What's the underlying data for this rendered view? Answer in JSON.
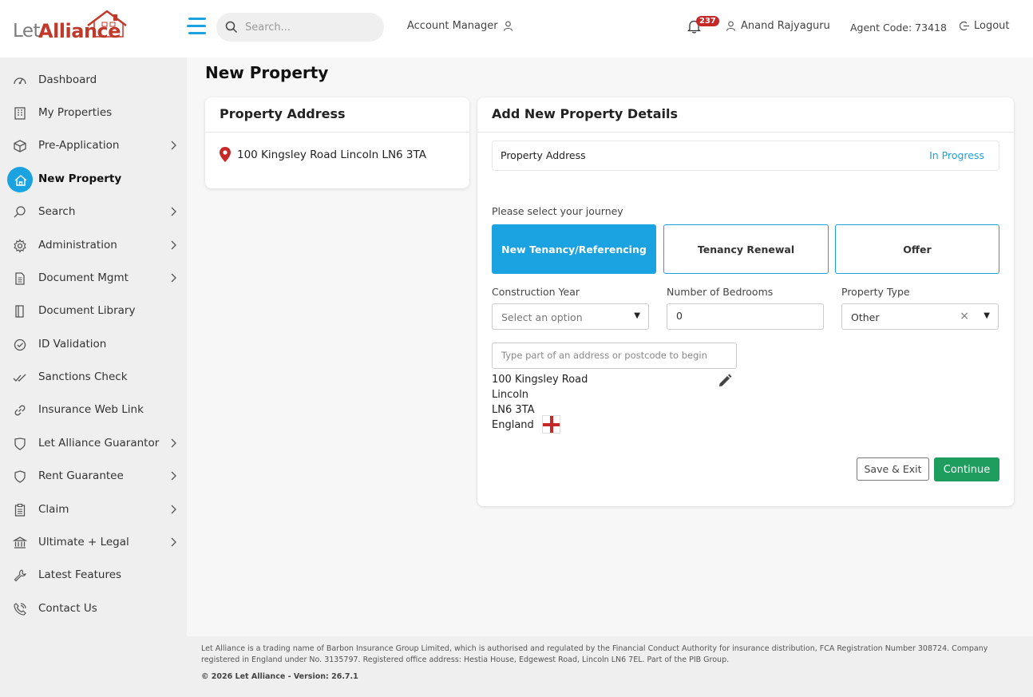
{
  "header": {
    "logo_let": "Let",
    "logo_alliance": "Alliance",
    "search_placeholder": "Search...",
    "account_manager": "Account Manager",
    "notification_count": "237",
    "user_name": "Anand Rajyaguru",
    "agent_code": "Agent Code: 73418",
    "logout": "Logout"
  },
  "sidebar": {
    "items": [
      {
        "label": "Dashboard",
        "icon": "dashboard-icon",
        "chevron": false
      },
      {
        "label": "My Properties",
        "icon": "building-icon",
        "chevron": false
      },
      {
        "label": "Pre-Application",
        "icon": "box-icon",
        "chevron": true
      },
      {
        "label": "New Property",
        "icon": "home-icon",
        "chevron": false,
        "active": true
      },
      {
        "label": "Search",
        "icon": "search-icon",
        "chevron": true
      },
      {
        "label": "Administration",
        "icon": "gear-icon",
        "chevron": true
      },
      {
        "label": "Document Mgmt",
        "icon": "document-icon",
        "chevron": true
      },
      {
        "label": "Document Library",
        "icon": "book-icon",
        "chevron": false
      },
      {
        "label": "ID Validation",
        "icon": "check-circle-icon",
        "chevron": false
      },
      {
        "label": "Sanctions Check",
        "icon": "double-check-icon",
        "chevron": false
      },
      {
        "label": "Insurance Web Link",
        "icon": "link-icon",
        "chevron": false
      },
      {
        "label": "Let Alliance Guarantor",
        "icon": "shield-check-icon",
        "chevron": true
      },
      {
        "label": "Rent Guarantee",
        "icon": "shield-icon",
        "chevron": true
      },
      {
        "label": "Claim",
        "icon": "clipboard-icon",
        "chevron": true
      },
      {
        "label": "Ultimate + Legal",
        "icon": "bank-icon",
        "chevron": true
      },
      {
        "label": "Latest Features",
        "icon": "wrench-icon",
        "chevron": false
      },
      {
        "label": "Contact Us",
        "icon": "phone-icon",
        "chevron": false
      }
    ]
  },
  "main": {
    "page_title": "New Property",
    "left_card": {
      "title": "Property Address",
      "address": "100 Kingsley Road Lincoln LN6 3TA"
    },
    "right_card": {
      "title": "Add New Property Details",
      "status_label": "Property Address",
      "status_value": "In Progress",
      "journey_label": "Please select your journey",
      "journeys": [
        "New Tenancy/Referencing",
        "Tenancy Renewal",
        "Offer"
      ],
      "construction_year_label": "Construction Year",
      "construction_year_value": "Select an option",
      "bedrooms_label": "Number of Bedrooms",
      "bedrooms_value": "0",
      "property_type_label": "Property Type",
      "property_type_value": "Other",
      "address_search_placeholder": "Type part of an address or postcode to begin",
      "address_lines": [
        "100 Kingsley Road",
        "Lincoln",
        "LN6 3TA",
        "England"
      ],
      "save_exit": "Save & Exit",
      "continue": "Continue"
    }
  },
  "footer": {
    "legal": "Let Alliance is a trading name of Barbon Insurance Group Limited, which is authorised and regulated by the Financial Conduct Authority for insurance distribution, FCA Registration Number 308724. Company registered in England under No. 3135797. Registered office address: Hestia House, Edgewest Road, Lincoln LN6 7EL. Part of the PIB Group.",
    "copyright": "© 2026 Let Alliance - Version: 26.7.1"
  },
  "colors": {
    "accent": "#1aa3e0",
    "brand_red": "#c0392b",
    "continue_green": "#1e9e5e",
    "badge_red": "#c62828"
  }
}
